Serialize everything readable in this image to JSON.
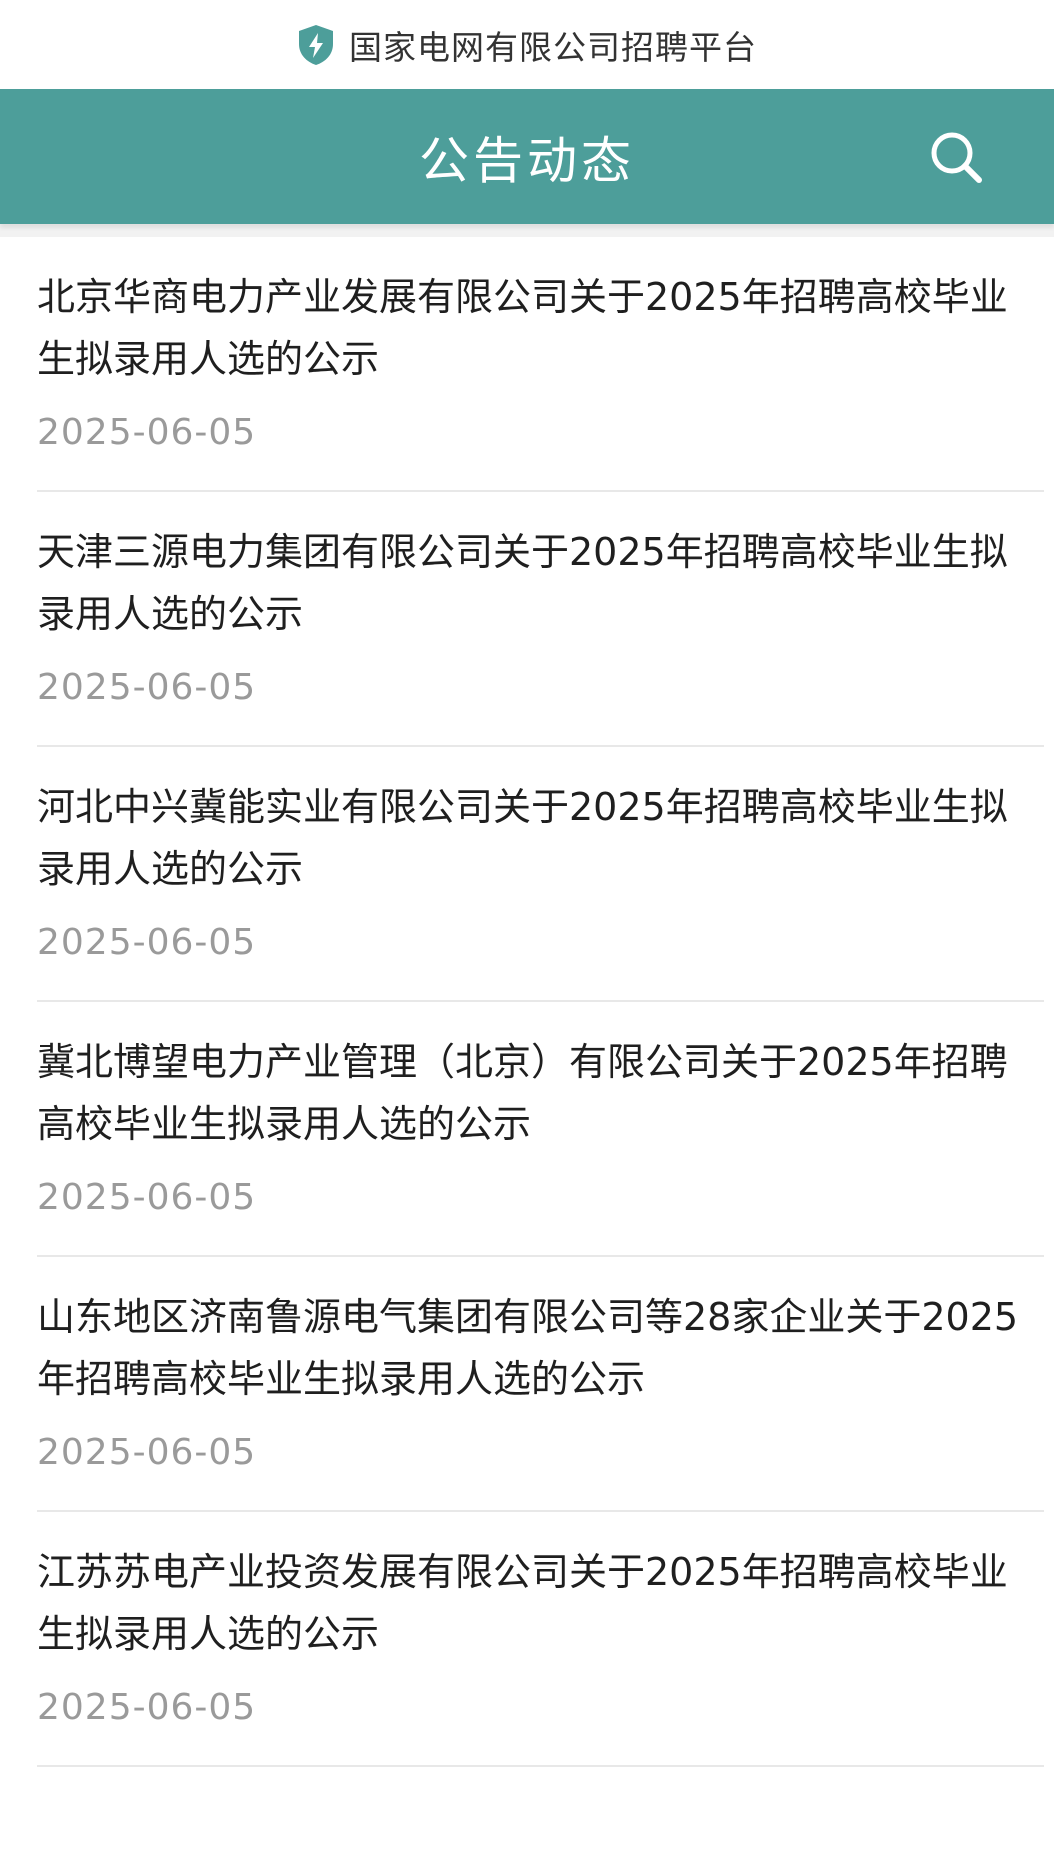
{
  "site": {
    "title": "国家电网有限公司招聘平台"
  },
  "header": {
    "title": "公告动态"
  },
  "colors": {
    "header_bg": "#4d9e9a",
    "title_text": "#1f1f1f",
    "date_text": "#9a9a9a"
  },
  "icons": {
    "site": "shield-bolt-icon",
    "search": "search-icon"
  },
  "announcements": [
    {
      "title": "北京华商电力产业发展有限公司关于2025年招聘高校毕业生拟录用人选的公示",
      "date": "2025-06-05"
    },
    {
      "title": "天津三源电力集团有限公司关于2025年招聘高校毕业生拟录用人选的公示",
      "date": "2025-06-05"
    },
    {
      "title": "河北中兴冀能实业有限公司关于2025年招聘高校毕业生拟录用人选的公示",
      "date": "2025-06-05"
    },
    {
      "title": "冀北博望电力产业管理（北京）有限公司关于2025年招聘高校毕业生拟录用人选的公示",
      "date": "2025-06-05"
    },
    {
      "title": "山东地区济南鲁源电气集团有限公司等28家企业关于2025年招聘高校毕业生拟录用人选的公示",
      "date": "2025-06-05"
    },
    {
      "title": "江苏苏电产业投资发展有限公司关于2025年招聘高校毕业生拟录用人选的公示",
      "date": "2025-06-05"
    }
  ]
}
